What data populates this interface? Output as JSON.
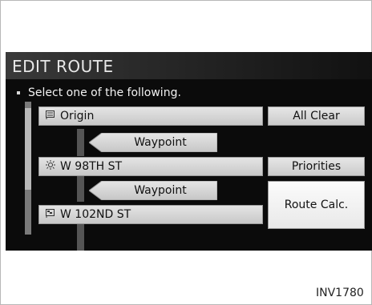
{
  "window": {
    "title": "EDIT ROUTE"
  },
  "instruction": "Select one of the following.",
  "route": {
    "origin": {
      "label": "Origin",
      "icon": "flag-icon"
    },
    "waypoint_label": "Waypoint",
    "stops": [
      {
        "label": "W 98TH ST",
        "icon": "sun-icon"
      },
      {
        "label": "W 102ND ST",
        "icon": "destination-flag-icon"
      }
    ]
  },
  "buttons": {
    "all_clear": "All Clear",
    "priorities": "Priorities",
    "route_calc": "Route Calc."
  },
  "caption": "INV1780",
  "colors": {
    "screen_background": "#0b0b0b",
    "button_face": "#d6d6d6",
    "text": "#111111"
  }
}
